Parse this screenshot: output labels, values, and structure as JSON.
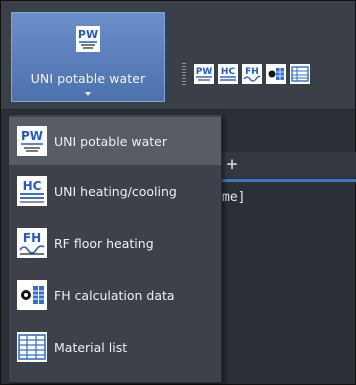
{
  "ribbon": {
    "big_button": {
      "label": "UNI potable water",
      "icon": "pw-icon"
    },
    "toolbar": {
      "buttons": [
        {
          "icon": "pw-small-icon"
        },
        {
          "icon": "hc-small-icon"
        },
        {
          "icon": "fh-small-icon"
        },
        {
          "icon": "fh-calc-small-icon"
        },
        {
          "icon": "material-list-small-icon"
        }
      ]
    }
  },
  "document": {
    "new_tab_label": "+",
    "text": "me]"
  },
  "menu": {
    "items": [
      {
        "label": "UNI potable water",
        "icon": "pw-icon",
        "selected": true
      },
      {
        "label": "UNI heating/cooling",
        "icon": "hc-icon",
        "selected": false
      },
      {
        "label": "RF floor heating",
        "icon": "fh-icon",
        "selected": false
      },
      {
        "label": "FH calculation data",
        "icon": "fh-calc-icon",
        "selected": false
      },
      {
        "label": "Material list",
        "icon": "material-list-icon",
        "selected": false
      }
    ]
  },
  "colors": {
    "accent_blue": "#2f6fd1",
    "selected_bg": "#585c64",
    "menu_bg": "#3e4149",
    "ribbon_button": "#5b80bd"
  },
  "icon_text": {
    "pw": "PW",
    "hc": "HC",
    "fh": "FH"
  }
}
